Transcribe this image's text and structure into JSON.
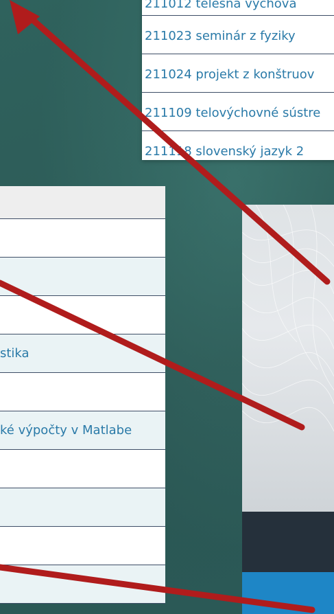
{
  "top_list": {
    "items": [
      "211012 telesná výchova",
      "211023 seminár z fyziky",
      "211024 projekt z konštruov",
      "211109 telovýchovné sústre",
      "211118 slovenský jazyk 2"
    ]
  },
  "left_table": {
    "rows": [
      "",
      "",
      "",
      "stika",
      "",
      "ké výpočty v Matlabe",
      "",
      "",
      "",
      ""
    ]
  },
  "colors": {
    "link_text": "#2a7aa8",
    "arrow": "#b01c1c",
    "background": "#2d5c58"
  }
}
